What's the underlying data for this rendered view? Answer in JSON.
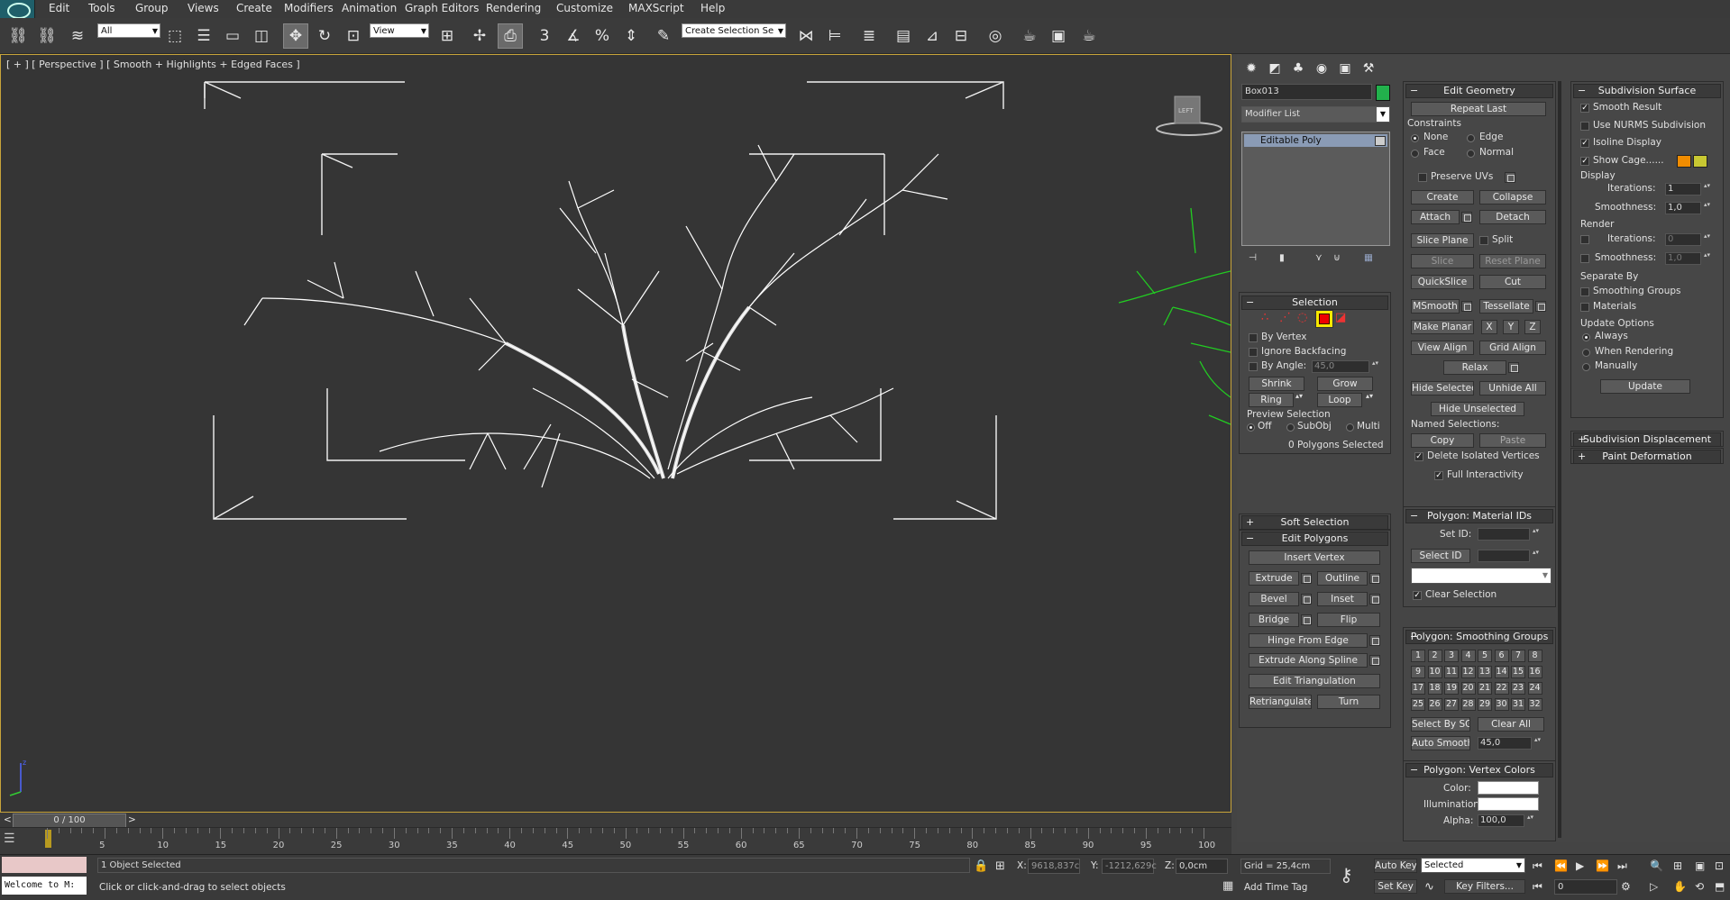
{
  "menu": [
    "Edit",
    "Tools",
    "Group",
    "Views",
    "Create",
    "Modifiers",
    "Animation",
    "Graph Editors",
    "Rendering",
    "Customize",
    "MAXScript",
    "Help"
  ],
  "toolbar": {
    "filter_value": "All",
    "refcoord_value": "View",
    "named_selection_placeholder": "Create Selection Se"
  },
  "viewport": {
    "label": "[ + ] [ Perspective ] [ Smooth + Highlights + Edged Faces ]",
    "viewcube_text": "LEFT"
  },
  "command_panel": {
    "object_name": "Box013",
    "object_color": "#22b14c",
    "modifier_list": "Modifier List",
    "stack_item": "Editable Poly",
    "selection": {
      "title": "Selection",
      "by_vertex": "By Vertex",
      "ignore_backfacing": "Ignore Backfacing",
      "by_angle": "By Angle:",
      "angle_value": "45,0",
      "shrink": "Shrink",
      "grow": "Grow",
      "ring": "Ring",
      "loop": "Loop",
      "preview_title": "Preview Selection",
      "off": "Off",
      "subobj": "SubObj",
      "multi": "Multi",
      "status": "0 Polygons Selected"
    },
    "soft_selection": "Soft Selection",
    "edit_polygons": {
      "title": "Edit Polygons",
      "insert_vertex": "Insert Vertex",
      "extrude": "Extrude",
      "outline": "Outline",
      "bevel": "Bevel",
      "inset": "Inset",
      "bridge": "Bridge",
      "flip": "Flip",
      "hinge": "Hinge From Edge",
      "extrude_spline": "Extrude Along Spline",
      "edit_triangulation": "Edit Triangulation",
      "retriangulate": "Retriangulate",
      "turn": "Turn"
    },
    "edit_geometry": {
      "title": "Edit Geometry",
      "repeat_last": "Repeat Last",
      "constraints": "Constraints",
      "none": "None",
      "edge": "Edge",
      "face": "Face",
      "normal": "Normal",
      "preserve_uvs": "Preserve UVs",
      "create": "Create",
      "collapse": "Collapse",
      "attach": "Attach",
      "detach": "Detach",
      "slice_plane": "Slice Plane",
      "split": "Split",
      "slice": "Slice",
      "reset_plane": "Reset Plane",
      "quickslice": "QuickSlice",
      "cut": "Cut",
      "msmooth": "MSmooth",
      "tessellate": "Tessellate",
      "make_planar": "Make Planar",
      "x": "X",
      "y": "Y",
      "z": "Z",
      "view_align": "View Align",
      "grid_align": "Grid Align",
      "relax": "Relax",
      "hide_selected": "Hide Selected",
      "unhide_all": "Unhide All",
      "hide_unselected": "Hide Unselected",
      "named_selections": "Named Selections:",
      "copy": "Copy",
      "paste": "Paste",
      "delete_isolated": "Delete Isolated Vertices",
      "full_interactivity": "Full Interactivity"
    },
    "material_ids": {
      "title": "Polygon: Material IDs",
      "set_id": "Set ID:",
      "select_id": "Select ID",
      "clear_selection": "Clear Selection"
    },
    "smoothing_groups": {
      "title": "Polygon: Smoothing Groups",
      "numbers": [
        "1",
        "2",
        "3",
        "4",
        "5",
        "6",
        "7",
        "8",
        "9",
        "10",
        "11",
        "12",
        "13",
        "14",
        "15",
        "16",
        "17",
        "18",
        "19",
        "20",
        "21",
        "22",
        "23",
        "24",
        "25",
        "26",
        "27",
        "28",
        "29",
        "30",
        "31",
        "32"
      ],
      "select_by_sg": "Select By SG",
      "clear_all": "Clear All",
      "auto_smooth": "Auto Smooth",
      "auto_smooth_value": "45,0"
    },
    "vertex_colors": {
      "title": "Polygon: Vertex Colors",
      "color": "Color:",
      "illumination": "Illumination:",
      "alpha": "Alpha:",
      "alpha_value": "100,0"
    },
    "subdivision_surface": {
      "title": "Subdivision Surface",
      "smooth_result": "Smooth Result",
      "use_nurms": "Use NURMS Subdivision",
      "isoline_display": "Isoline Display",
      "show_cage": "Show Cage......",
      "display": "Display",
      "iterations": "Iterations:",
      "iterations_value": "1",
      "smoothness": "Smoothness:",
      "smoothness_value": "1,0",
      "render": "Render",
      "render_iterations_value": "0",
      "render_smoothness_value": "1,0",
      "separate_by": "Separate By",
      "smoothing_groups": "Smoothing Groups",
      "materials": "Materials",
      "update_options": "Update Options",
      "always": "Always",
      "when_rendering": "When Rendering",
      "manually": "Manually",
      "update": "Update"
    },
    "subdivision_displacement": "Subdivision Displacement",
    "paint_deformation": "Paint Deformation"
  },
  "timeline": {
    "frame_label": "0 / 100",
    "ticks": [
      "5",
      "10",
      "15",
      "20",
      "25",
      "30",
      "35",
      "40",
      "45",
      "50",
      "55",
      "60",
      "65",
      "70",
      "75",
      "80",
      "85",
      "90",
      "95",
      "100"
    ]
  },
  "status": {
    "maxscript_text": "Welcome to M:",
    "selection_info": "1 Object Selected",
    "prompt": "Click or click-and-drag to select objects",
    "x_label": "X:",
    "x_value": "9618,837c",
    "y_label": "Y:",
    "y_value": "-1212,629c",
    "z_label": "Z:",
    "z_value": "0,0cm",
    "grid": "Grid = 25,4cm",
    "add_time_tag": "Add Time Tag",
    "auto_key": "Auto Key",
    "selected_value": "Selected",
    "set_key": "Set Key",
    "key_filters": "Key Filters...",
    "frame_value": "0"
  }
}
